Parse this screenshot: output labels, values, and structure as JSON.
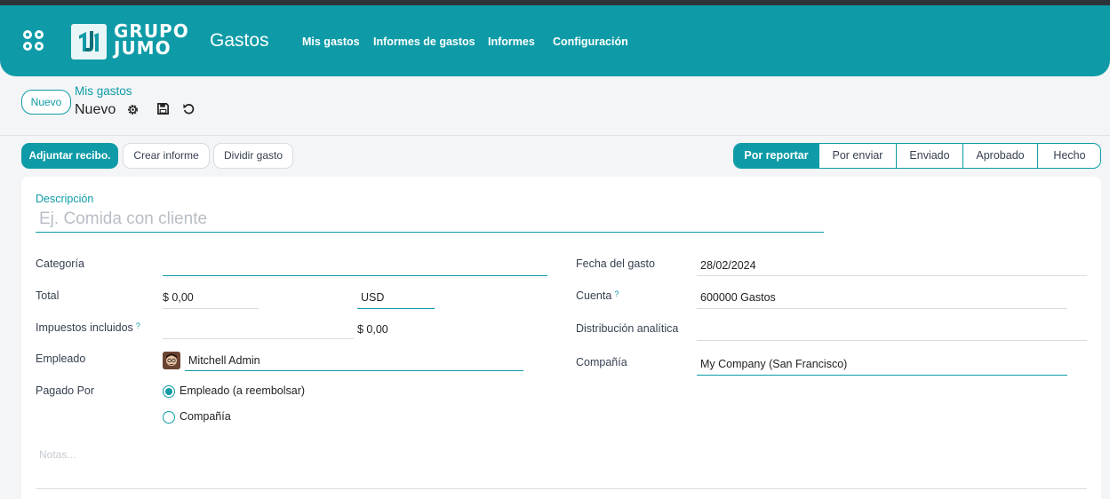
{
  "navbar": {
    "logo_line1": "GRUPO",
    "logo_line2": "JUMO",
    "app_title": "Gastos",
    "menu": [
      "Mis gastos",
      "Informes de gastos",
      "Informes",
      "Configuración"
    ]
  },
  "control_panel": {
    "new_button": "Nuevo",
    "breadcrumb_parent": "Mis gastos",
    "breadcrumb_current": "Nuevo"
  },
  "actions": {
    "attach_receipt": "Adjuntar recibo.",
    "create_report": "Crear informe",
    "split_expense": "Dividir gasto"
  },
  "statusbar": {
    "stages": [
      "Por reportar",
      "Por enviar",
      "Enviado",
      "Aprobado",
      "Hecho"
    ],
    "active_index": 0
  },
  "form": {
    "description_label": "Descripción",
    "description_placeholder": "Ej. Comida con cliente",
    "category_label": "Categoría",
    "category_value": "",
    "total_label": "Total",
    "total_value": "$ 0,00",
    "currency_value": "USD",
    "taxes_label": "Impuestos incluidos",
    "taxes_help": "?",
    "taxes_amount": "$ 0,00",
    "employee_label": "Empleado",
    "employee_value": "Mitchell Admin",
    "paid_by_label": "Pagado Por",
    "paid_by_options": [
      "Empleado (a reembolsar)",
      "Compañía"
    ],
    "paid_by_selected": 0,
    "date_label": "Fecha del gasto",
    "date_value": "28/02/2024",
    "account_label": "Cuenta",
    "account_help": "?",
    "account_value": "600000 Gastos",
    "analytic_label": "Distribución analítica",
    "analytic_value": "",
    "company_label": "Compañía",
    "company_value": "My Company (San Francisco)",
    "notes_placeholder": "Notas..."
  },
  "colors": {
    "brand": "#0e9ba7",
    "topbar": "#2e3338"
  }
}
